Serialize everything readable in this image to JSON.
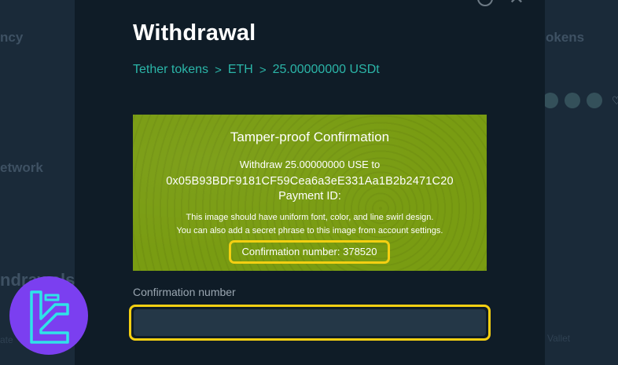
{
  "background": {
    "left_labels": [
      "ncy",
      "etwork",
      "ndrawals"
    ],
    "right_labels": [
      "okens",
      "Vallet"
    ],
    "left_small_texts": [
      "ate"
    ]
  },
  "modal": {
    "title": "Withdrawal",
    "breadcrumb": [
      "Tether tokens",
      "ETH",
      "25.00000000 USDt"
    ],
    "breadcrumb_separator": ">",
    "close_symbol": "✕",
    "confirmation": {
      "heading": "Tamper-proof Confirmation",
      "line1": "Withdraw 25.00000000 USE to",
      "address": "0x05B93BDF9181CF59Cea6a3eE331Aa1B2b2471C20",
      "payment_id": "Payment ID:",
      "note1": "This image should have uniform font, color,  and line swirl design.",
      "note2": "You can also add a secret phrase to this image from account settings.",
      "number_text": "Confirmation number: 378520"
    },
    "field": {
      "label": "Confirmation number",
      "value": "",
      "placeholder": ""
    }
  },
  "colors": {
    "accent": "#2bb5a8",
    "highlight": "#f4cf12",
    "confirm_bg": "#799c12",
    "logo_bg": "#7b3ff0",
    "logo_fg": "#2fe3e8"
  }
}
